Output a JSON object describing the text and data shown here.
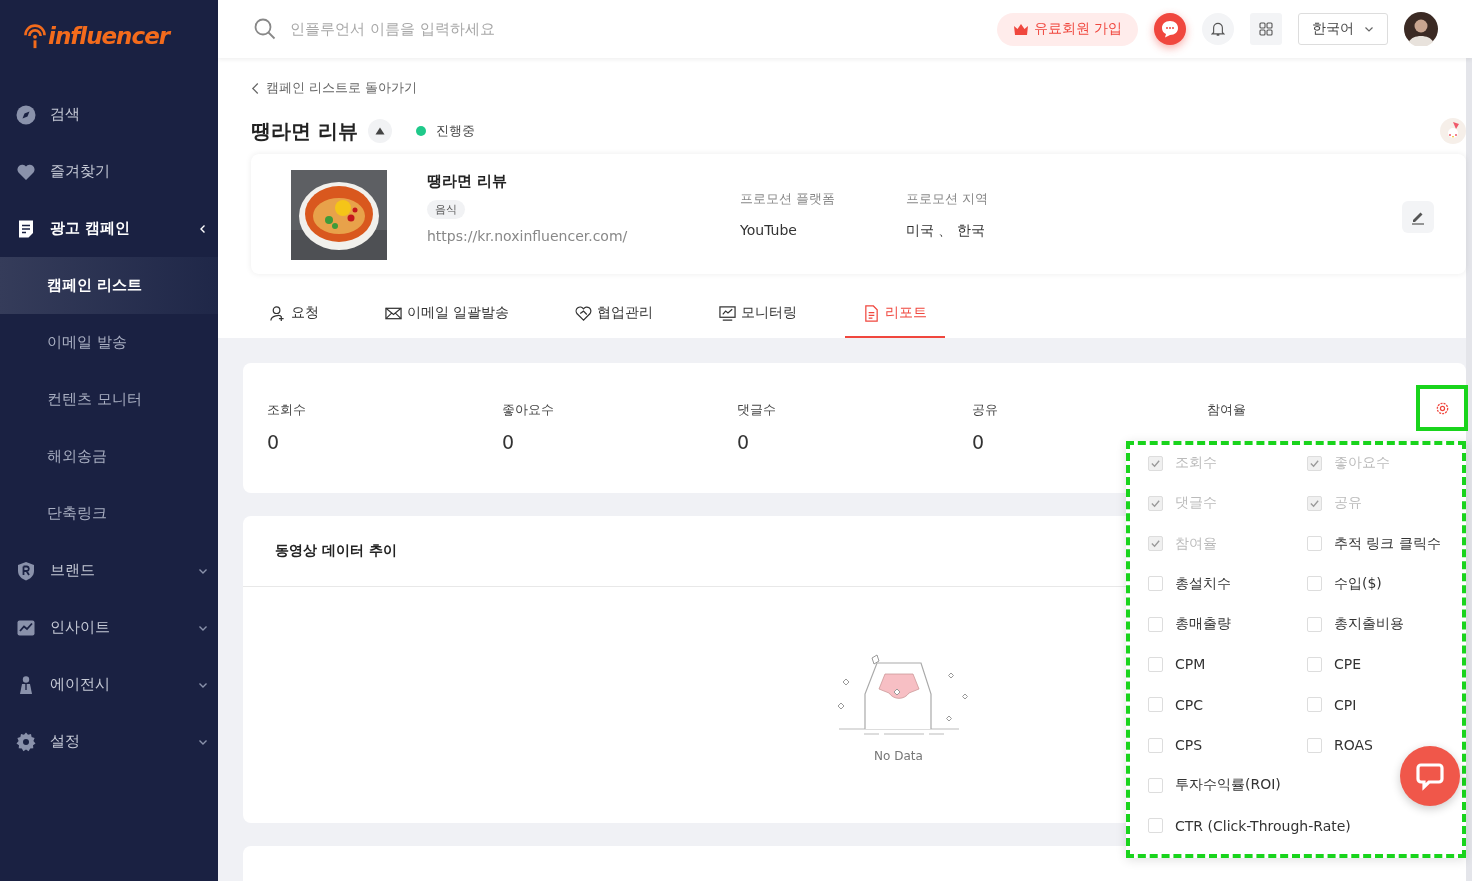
{
  "sidebar": {
    "logo": "influencer",
    "items": [
      {
        "label": "검색",
        "selected": false
      },
      {
        "label": "즐겨찾기",
        "selected": false
      },
      {
        "label": "광고 캠페인",
        "selected": true,
        "expanded": true,
        "children": [
          {
            "label": "캠페인 리스트",
            "selected": true
          },
          {
            "label": "이메일 발송",
            "selected": false
          },
          {
            "label": "컨텐츠 모니터",
            "selected": false
          },
          {
            "label": "해외송금",
            "selected": false
          },
          {
            "label": "단축링크",
            "selected": false
          }
        ]
      },
      {
        "label": "브랜드",
        "selected": false,
        "expanded": false
      },
      {
        "label": "인사이트",
        "selected": false,
        "expanded": false
      },
      {
        "label": "에이전시",
        "selected": false,
        "expanded": false
      },
      {
        "label": "설정",
        "selected": false,
        "expanded": false
      }
    ]
  },
  "topbar": {
    "search_placeholder": "인플루언서 이름을 입력하세요",
    "upgrade_button": "유료회원 가입",
    "language": "한국어"
  },
  "campaign": {
    "back_link": "캠페인 리스트로 돌아가기",
    "title": "땡라면 리뷰",
    "status": "진행중",
    "card": {
      "name": "땡라면 리뷰",
      "tag": "음식",
      "url": "https://kr.noxinfluencer.com/",
      "fields": [
        {
          "label": "프로모션 플랫폼",
          "value": "YouTube"
        },
        {
          "label": "프로모션 지역",
          "value": "미국 、 한국"
        }
      ]
    }
  },
  "tabs": [
    {
      "label": "요청",
      "selected": false
    },
    {
      "label": "이메일 일괄발송",
      "selected": false
    },
    {
      "label": "협업관리",
      "selected": false
    },
    {
      "label": "모니터링",
      "selected": false
    },
    {
      "label": "리포트",
      "selected": true
    }
  ],
  "stats": {
    "settings_highlighted": true,
    "items": [
      {
        "label": "조회수",
        "value": "0"
      },
      {
        "label": "좋아요수",
        "value": "0"
      },
      {
        "label": "댓글수",
        "value": "0"
      },
      {
        "label": "공유",
        "value": "0"
      },
      {
        "label": "참여율"
      }
    ]
  },
  "metric_menu": {
    "highlighted": true,
    "options": [
      {
        "label": "조회수",
        "checked": true,
        "disabled": true,
        "wide": false
      },
      {
        "label": "좋아요수",
        "checked": true,
        "disabled": true,
        "wide": false
      },
      {
        "label": "댓글수",
        "checked": true,
        "disabled": true,
        "wide": false
      },
      {
        "label": "공유",
        "checked": true,
        "disabled": true,
        "wide": false
      },
      {
        "label": "참여율",
        "checked": true,
        "disabled": true,
        "wide": false
      },
      {
        "label": "추적 링크 클릭수",
        "checked": false,
        "disabled": false,
        "wide": false
      },
      {
        "label": "총설치수",
        "checked": false,
        "disabled": false,
        "wide": false
      },
      {
        "label": "수입($)",
        "checked": false,
        "disabled": false,
        "wide": false
      },
      {
        "label": "총매출량",
        "checked": false,
        "disabled": false,
        "wide": false
      },
      {
        "label": "총지출비용",
        "checked": false,
        "disabled": false,
        "wide": false
      },
      {
        "label": "CPM",
        "checked": false,
        "disabled": false,
        "wide": false
      },
      {
        "label": "CPE",
        "checked": false,
        "disabled": false,
        "wide": false
      },
      {
        "label": "CPC",
        "checked": false,
        "disabled": false,
        "wide": false
      },
      {
        "label": "CPI",
        "checked": false,
        "disabled": false,
        "wide": false
      },
      {
        "label": "CPS",
        "checked": false,
        "disabled": false,
        "wide": false
      },
      {
        "label": "ROAS",
        "checked": false,
        "disabled": false,
        "wide": false
      },
      {
        "label": "투자수익률(ROI)",
        "checked": false,
        "disabled": false,
        "wide": true
      },
      {
        "label": "CTR (Click-Through-Rate)",
        "checked": false,
        "disabled": false,
        "wide": true
      }
    ]
  },
  "trend": {
    "title": "동영상 데이터 추이",
    "empty_text": "No Data"
  }
}
